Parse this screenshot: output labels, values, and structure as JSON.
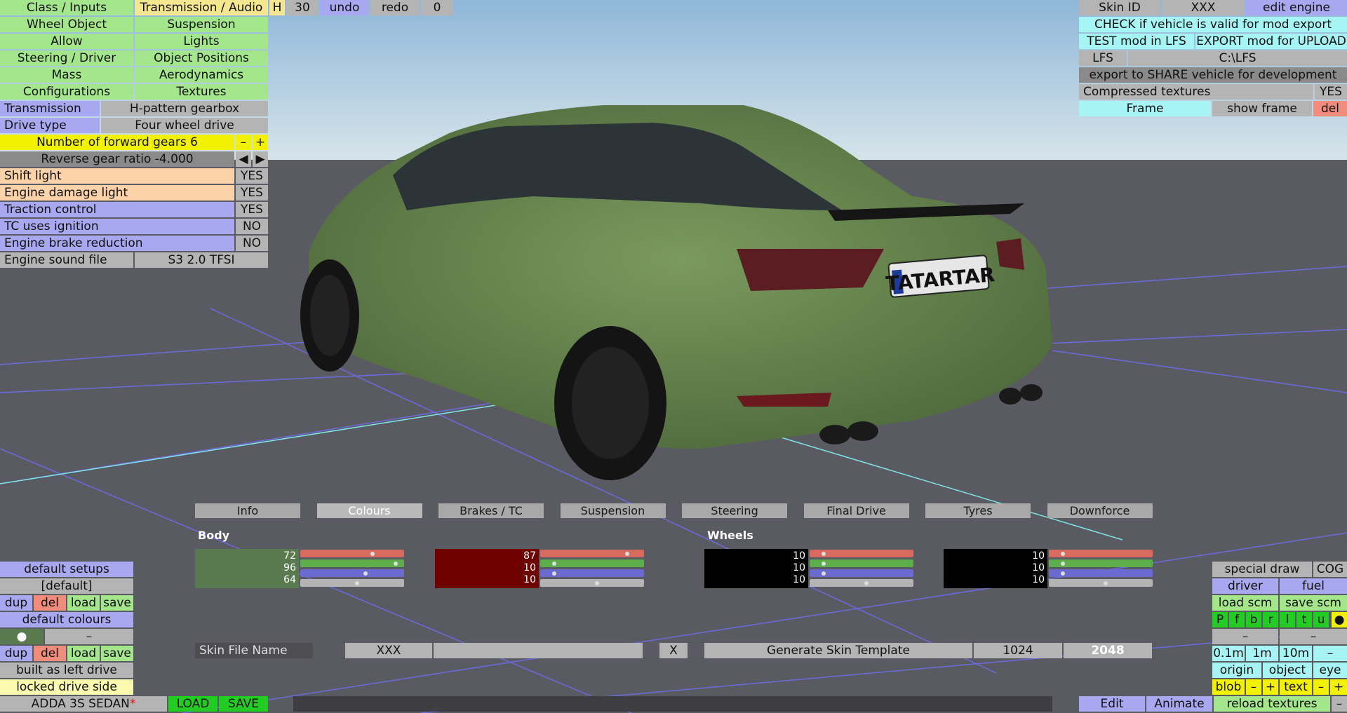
{
  "top_left_menu": {
    "row1": [
      "Class / Inputs",
      "Transmission / Audio"
    ],
    "row2": [
      "Wheel Object",
      "Suspension"
    ],
    "row3": [
      "Allow",
      "Lights"
    ],
    "row4": [
      "Steering / Driver",
      "Object Positions"
    ],
    "row5": [
      "Mass",
      "Aerodynamics"
    ],
    "row6": [
      "Configurations",
      "Textures"
    ]
  },
  "top_toolbar": {
    "h": "H",
    "num": "30",
    "undo": "undo",
    "redo": "redo",
    "count": "0"
  },
  "settings": {
    "transmission_label": "Transmission",
    "transmission_value": "H-pattern gearbox",
    "drive_label": "Drive type",
    "drive_value": "Four wheel drive",
    "gears": "Number of forward gears 6",
    "minus": "–",
    "plus": "+",
    "reverse": "Reverse gear ratio -4.000",
    "left": "◀",
    "right": "▶",
    "shift_light": "Shift light",
    "shift_light_val": "YES",
    "damage_light": "Engine damage light",
    "damage_light_val": "YES",
    "traction": "Traction control",
    "traction_val": "YES",
    "tc_ign": "TC uses ignition",
    "tc_ign_val": "NO",
    "brake_red": "Engine brake reduction",
    "brake_red_val": "NO",
    "sound": "Engine sound file",
    "sound_val": "S3 2.0 TFSI"
  },
  "top_right": {
    "skin_id": "Skin ID",
    "skin_val": "XXX",
    "edit_engine": "edit engine",
    "check": "CHECK if vehicle is valid for mod export",
    "test": "TEST mod in LFS",
    "export": "EXPORT mod for UPLOAD",
    "lfs": "LFS",
    "path": "C:\\LFS",
    "share": "export to SHARE vehicle for development",
    "compressed": "Compressed textures",
    "compressed_val": "YES",
    "frame": "Frame",
    "show_frame": "show frame",
    "del": "del"
  },
  "plate": "TATARTAR",
  "tabs": [
    "Info",
    "Colours",
    "Brakes / TC",
    "Suspension",
    "Steering",
    "Final Drive",
    "Tyres",
    "Downforce"
  ],
  "colours": {
    "body_label": "Body",
    "wheels_label": "Wheels",
    "swatches": [
      {
        "color": "#587a4e",
        "r": "72",
        "g": "96",
        "b": "64"
      },
      {
        "color": "#6e0000",
        "r": "87",
        "g": "10",
        "b": "10"
      },
      {
        "color": "#000000",
        "r": "10",
        "g": "10",
        "b": "10"
      },
      {
        "color": "#000000",
        "r": "10",
        "g": "10",
        "b": "10"
      }
    ]
  },
  "skin_row": {
    "label": "Skin File Name",
    "xxx": "XXX",
    "x": "X",
    "generate": "Generate Skin Template",
    "s1024": "1024",
    "s2048": "2048"
  },
  "left_bottom": {
    "default_setups": "default setups",
    "default": "[default]",
    "dup": "dup",
    "del": "del",
    "load": "load",
    "save": "save",
    "default_colours": "default colours",
    "dot": "●",
    "dash": "–",
    "left_drive": "built as left drive",
    "locked": "locked drive side",
    "car_name": "ADDA 3S SEDAN",
    "asterisk": "*",
    "LOAD": "LOAD",
    "SAVE": "SAVE"
  },
  "right_bottom": {
    "special": "special draw",
    "cog": "COG",
    "driver": "driver",
    "fuel": "fuel",
    "load_scm": "load scm",
    "save_scm": "save scm",
    "letters": [
      "P",
      "f",
      "b",
      "r",
      "l",
      "t",
      "u"
    ],
    "dot": "●",
    "dash": "–",
    "d01": "0.1m",
    "d1": "1m",
    "d10": "10m",
    "dm": "–",
    "origin": "origin",
    "object": "object",
    "eye": "eye",
    "blob": "blob",
    "minus": "–",
    "plus": "+",
    "text": "text",
    "edit": "Edit",
    "animate": "Animate",
    "reload": "reload textures",
    "rdash": "–"
  }
}
